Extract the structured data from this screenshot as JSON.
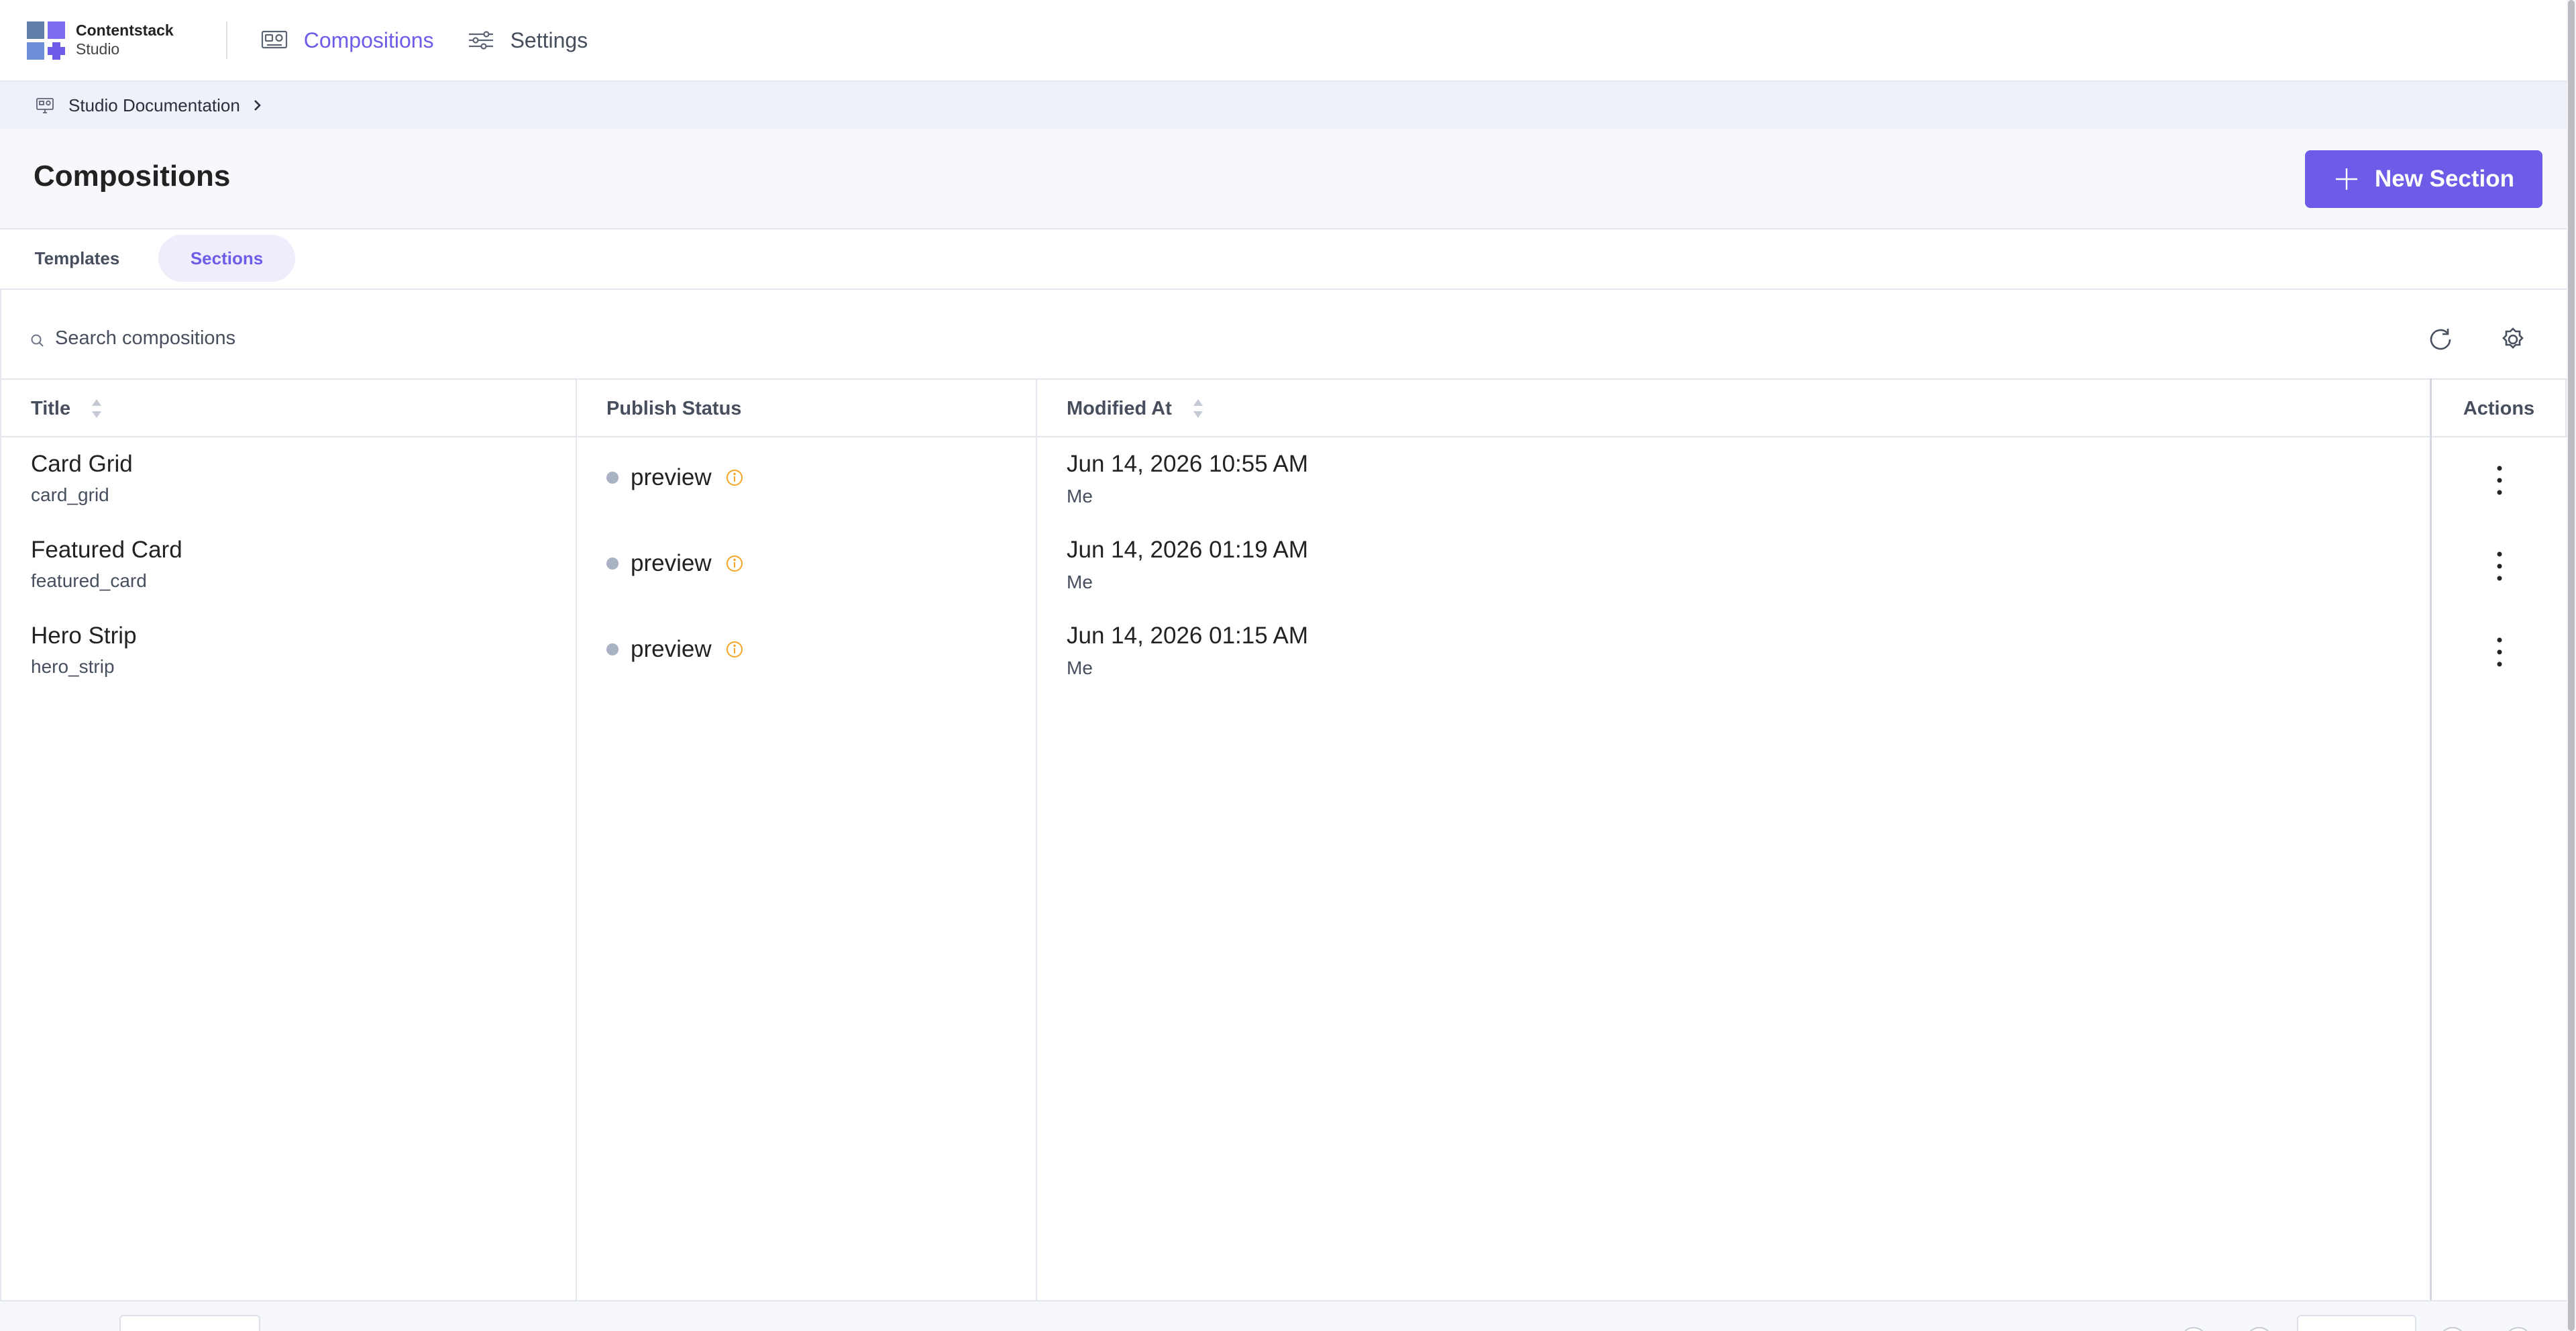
{
  "app": {
    "name": "Contentstack",
    "subtitle": "Studio"
  },
  "nav": {
    "items": [
      {
        "label": "Compositions",
        "icon": "compositions-icon",
        "active": true
      },
      {
        "label": "Settings",
        "icon": "sliders-icon",
        "active": false
      }
    ]
  },
  "breadcrumb": {
    "label": "Studio Documentation",
    "icon": "project-icon"
  },
  "page": {
    "title": "Compositions",
    "new_button_label": "New Section"
  },
  "tabs": [
    {
      "label": "Templates",
      "active": false
    },
    {
      "label": "Sections",
      "active": true
    }
  ],
  "search": {
    "placeholder": "Search compositions",
    "value": ""
  },
  "table": {
    "columns": {
      "title": "Title",
      "publish_status": "Publish Status",
      "modified_at": "Modified At",
      "actions": "Actions"
    },
    "rows": [
      {
        "title": "Card Grid",
        "uid": "card_grid",
        "status": "preview",
        "modified_at": "Jun 14, 2026 10:55 AM",
        "modified_by": "Me"
      },
      {
        "title": "Featured Card",
        "uid": "featured_card",
        "status": "preview",
        "modified_at": "Jun 14, 2026 01:19 AM",
        "modified_by": "Me"
      },
      {
        "title": "Hero Strip",
        "uid": "hero_strip",
        "status": "preview",
        "modified_at": "Jun 14, 2026 01:15 AM",
        "modified_by": "Me"
      }
    ]
  },
  "colors": {
    "accent": "#6c5ce7",
    "status_dot": "#a9b2c3",
    "info_icon": "#f5a623",
    "text_primary": "#222222",
    "text_secondary": "#474f5e",
    "border": "#e3e6ed"
  }
}
